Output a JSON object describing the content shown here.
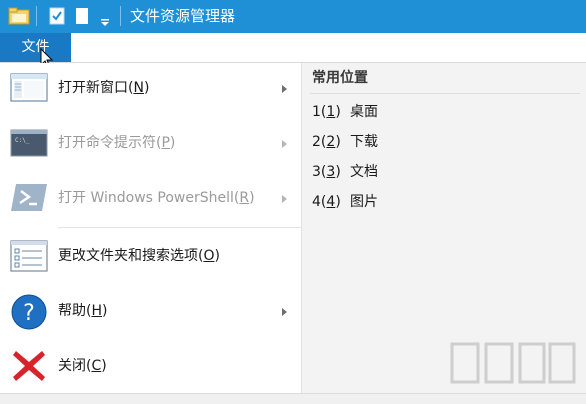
{
  "window": {
    "title": "文件资源管理器",
    "titlebar_color": "#1f8fd6"
  },
  "ribbon": {
    "file_tab_label": "文件",
    "file_tab_color": "#1979c4"
  },
  "menu": {
    "items": [
      {
        "label": "打开新窗口(N)",
        "text": "打开新窗口(",
        "key": "N",
        "icon": "new-window-icon",
        "enabled": true,
        "submenu": true
      },
      {
        "label": "打开命令提示符(P)",
        "text": "打开命令提示符(",
        "key": "P",
        "icon": "command-prompt-icon",
        "enabled": false,
        "submenu": true
      },
      {
        "label": "打开 Windows PowerShell(R)",
        "text": "打开 Windows PowerShell(",
        "key": "R",
        "icon": "powershell-icon",
        "enabled": false,
        "submenu": true
      },
      {
        "label": "更改文件夹和搜索选项(O)",
        "text": "更改文件夹和搜索选项(",
        "key": "O",
        "icon": "folder-options-icon",
        "enabled": true,
        "submenu": false
      },
      {
        "label": "帮助(H)",
        "text": "帮助(",
        "key": "H",
        "icon": "help-icon",
        "enabled": true,
        "submenu": true
      },
      {
        "label": "关闭(C)",
        "text": "关闭(",
        "key": "C",
        "icon": "close-icon",
        "enabled": true,
        "submenu": false
      }
    ]
  },
  "recent": {
    "header": "常用位置",
    "items": [
      {
        "num": "1",
        "key": "1",
        "name": "桌面"
      },
      {
        "num": "2",
        "key": "2",
        "name": "下载"
      },
      {
        "num": "3",
        "key": "3",
        "name": "文档"
      },
      {
        "num": "4",
        "key": "4",
        "name": "图片"
      }
    ]
  },
  "close_paren": ")"
}
